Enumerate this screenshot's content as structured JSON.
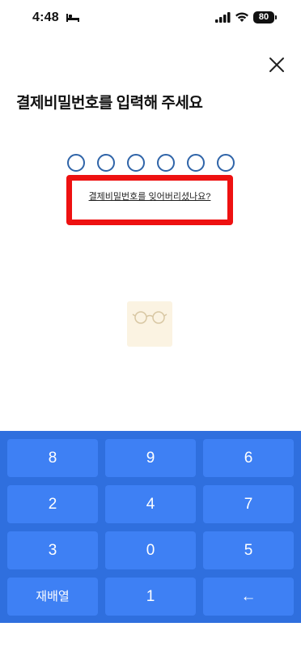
{
  "status_bar": {
    "time": "4:48",
    "battery": "80"
  },
  "page": {
    "title": "결제비밀번호를 입력해 주세요",
    "forgot_link": "결제비밀번호를 잊어버리셨나요?",
    "pin_length": 6
  },
  "keypad": {
    "rows": [
      [
        "8",
        "9",
        "6"
      ],
      [
        "2",
        "4",
        "7"
      ],
      [
        "3",
        "0",
        "5"
      ],
      [
        "재배열",
        "1",
        "←"
      ]
    ]
  },
  "colors": {
    "keypad_bg": "#2f6fde",
    "key_bg": "#3e80f4",
    "pin_dot_border": "#2f64a8",
    "highlight": "#ee1111"
  }
}
